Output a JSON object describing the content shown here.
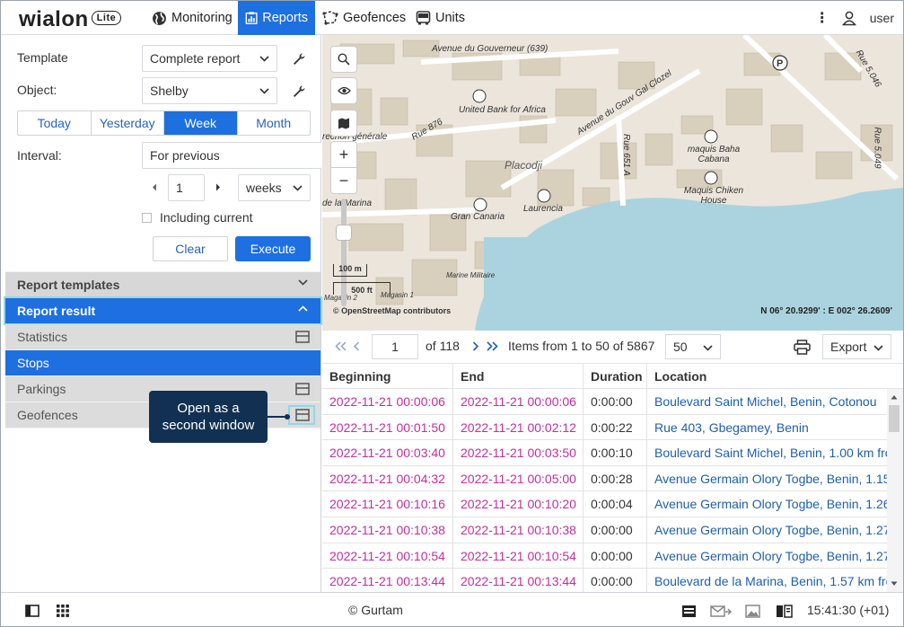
{
  "app": {
    "logo": "wialon",
    "edition": "Lite"
  },
  "nav": {
    "monitoring": "Monitoring",
    "reports": "Reports",
    "geofences": "Geofences",
    "units": "Units",
    "user": "user"
  },
  "form": {
    "template_label": "Template",
    "template_value": "Complete report",
    "object_label": "Object:",
    "object_value": "Shelby",
    "periods": [
      "Today",
      "Yesterday",
      "Week",
      "Month"
    ],
    "active_period": "Week",
    "interval_label": "Interval:",
    "interval_value": "For previous",
    "interval_count": "1",
    "interval_unit": "weeks",
    "including_current": "Including current",
    "clear": "Clear",
    "execute": "Execute"
  },
  "panels": {
    "report_templates": "Report templates",
    "report_result": "Report result",
    "items": [
      "Statistics",
      "Stops",
      "Parkings",
      "Geofences"
    ],
    "active_item": "Stops"
  },
  "tooltip": {
    "line1": "Open as a",
    "line2": "second window"
  },
  "map": {
    "coords": "N 06° 20.9299' : E 002° 26.2609'",
    "attribution": "© OpenStreetMap contributors",
    "scale_m": "100 m",
    "scale_ft": "500 ft",
    "labels": [
      "Avenue du Gouverneur (639)",
      "United Bank for Africa",
      "Avenue du Gouv Gal Clozel",
      "Rue 876",
      "recrion générale",
      "Placodji",
      "Rue 651 A",
      "Rue 5.046",
      "Rue 5.049",
      "maquis Baha Cabana",
      "Maquis Chiken House",
      "Laurencia",
      "Gran Canaria",
      "de la Marina",
      "Marine Militaire",
      "Magasin 2",
      "Magasin 1"
    ]
  },
  "table_bar": {
    "page": "1",
    "of_pages": "of 118",
    "items_text": "Items from 1 to 50 of 5867",
    "page_size": "50",
    "export": "Export"
  },
  "table": {
    "columns": [
      "Beginning",
      "End",
      "Duration",
      "Location"
    ],
    "rows": [
      [
        "2022-11-21 00:00:06",
        "2022-11-21 00:00:06",
        "0:00:00",
        "Boulevard Saint Michel, Benin, Cotonou"
      ],
      [
        "2022-11-21 00:01:50",
        "2022-11-21 00:02:12",
        "0:00:22",
        "Rue 403, Gbegamey, Benin"
      ],
      [
        "2022-11-21 00:03:40",
        "2022-11-21 00:03:50",
        "0:00:10",
        "Boulevard Saint Michel, Benin, 1.00 km fro"
      ],
      [
        "2022-11-21 00:04:32",
        "2022-11-21 00:05:00",
        "0:00:28",
        "Avenue Germain Olory Togbe, Benin, 1.15"
      ],
      [
        "2022-11-21 00:10:16",
        "2022-11-21 00:10:20",
        "0:00:04",
        "Avenue Germain Olory Togbe, Benin, 1.26"
      ],
      [
        "2022-11-21 00:10:38",
        "2022-11-21 00:10:38",
        "0:00:00",
        "Avenue Germain Olory Togbe, Benin, 1.27"
      ],
      [
        "2022-11-21 00:10:54",
        "2022-11-21 00:10:54",
        "0:00:00",
        "Avenue Germain Olory Togbe, Benin, 1.27"
      ],
      [
        "2022-11-21 00:13:44",
        "2022-11-21 00:13:44",
        "0:00:00",
        "Boulevard de la Marina, Benin, 1.57 km fro"
      ]
    ]
  },
  "footer": {
    "copyright": "© Gurtam",
    "time": "15:41:30 (+01)"
  },
  "colors": {
    "accent": "#1e6fe0",
    "time_text": "#c0309a",
    "location_text": "#1f5fa8",
    "tooltip_bg": "#123152"
  }
}
